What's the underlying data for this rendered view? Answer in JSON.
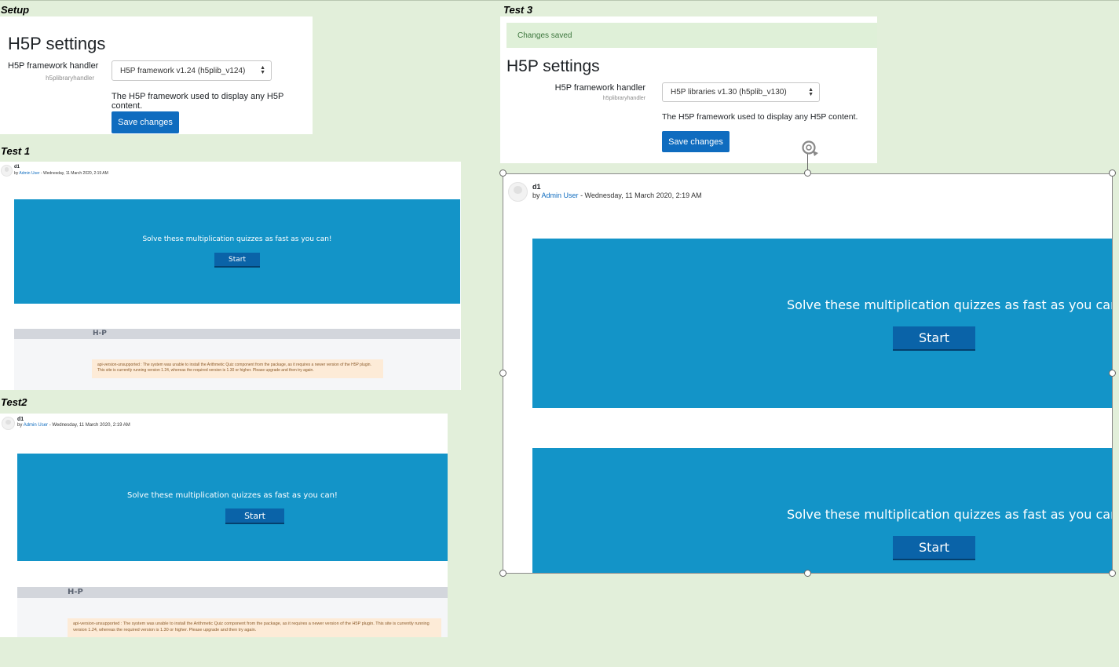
{
  "labels": {
    "setup": "Setup",
    "test1": "Test 1",
    "test2": "Test2",
    "test3": "Test 3"
  },
  "setup": {
    "title": "H5P settings",
    "field_label": "H5P framework handler",
    "field_sub": "h5plibraryhandler",
    "select_value": "H5P framework v1.24 (h5plib_v124)",
    "description": "The H5P framework used to display any H5P content.",
    "save_label": "Save changes"
  },
  "test3_settings": {
    "notice": "Changes saved",
    "title": "H5P settings",
    "field_label": "H5P framework handler",
    "field_sub": "h5plibraryhandler",
    "select_value": "H5P libraries v1.30 (h5plib_v130)",
    "description": "The H5P framework used to display any H5P content.",
    "save_label": "Save changes"
  },
  "post": {
    "title": "d1",
    "by": "by",
    "author": "Admin User",
    "date": "- Wednesday, 11 March 2020, 2:19 AM"
  },
  "quiz": {
    "prompt": "Solve these multiplication quizzes as fast as you can!",
    "start_label": "Start"
  },
  "h5p": {
    "logo": "H-P"
  },
  "error": {
    "message": "api-version-unsupported : The system was unable to install the Arithmetic Quiz component from the package, as it requires a newer version of the H5P plugin. This site is currently running version 1.24, whereas the required version is 1.30 or higher. Please upgrade and then try again."
  },
  "colors": {
    "background": "#e2efda",
    "brand": "#0f6cbf",
    "quiz_card": "#1394c8",
    "quiz_button": "#0a63a8",
    "notice_bg": "#dff0d8",
    "error_bg": "#fdebd7"
  }
}
